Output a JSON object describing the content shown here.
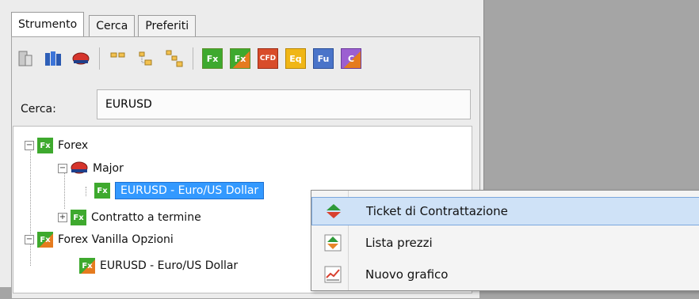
{
  "tabs": [
    {
      "label": "Strumento"
    },
    {
      "label": "Cerca"
    },
    {
      "label": "Preferiti"
    }
  ],
  "toolbar": {
    "type_buttons": [
      {
        "text": "Fx",
        "icon": "fx-icon"
      },
      {
        "text": "Fx",
        "icon": "fx-options-icon"
      },
      {
        "text": "CFD",
        "icon": "cfd-icon"
      },
      {
        "text": "Eq",
        "icon": "equity-icon"
      },
      {
        "text": "Fu",
        "icon": "futures-icon"
      },
      {
        "text": "C",
        "icon": "commodity-options-icon"
      }
    ]
  },
  "search": {
    "label": "Cerca:",
    "value": "EURUSD"
  },
  "tree": {
    "nodes": [
      {
        "label": "Forex",
        "icon": "fx-icon",
        "expander": "−"
      },
      {
        "label": "Major",
        "icon": "red-cap-icon",
        "expander": "−"
      },
      {
        "label": "EURUSD - Euro/US Dollar",
        "icon": "fx-icon",
        "selected": true
      },
      {
        "label": "Contratto a termine",
        "icon": "fx-icon",
        "expander": "+"
      },
      {
        "label": "Forex Vanilla Opzioni",
        "icon": "fx-options-icon",
        "expander": "−"
      },
      {
        "label": "EURUSD - Euro/US Dollar",
        "icon": "fx-options-icon"
      }
    ],
    "icon_text": {
      "fx": "Fx"
    }
  },
  "context_menu": {
    "items": [
      {
        "label": "Ticket di Contrattazione",
        "icon": "ticket-icon",
        "highlighted": true
      },
      {
        "label": "Lista prezzi",
        "icon": "price-list-icon"
      },
      {
        "label": "Nuovo grafico",
        "icon": "chart-icon"
      }
    ]
  },
  "colors": {
    "fx_green": "#3ea92e",
    "options_orange": "#e57b1f",
    "selection_blue": "#3399ff",
    "menu_highlight": "#cfe2f7"
  }
}
